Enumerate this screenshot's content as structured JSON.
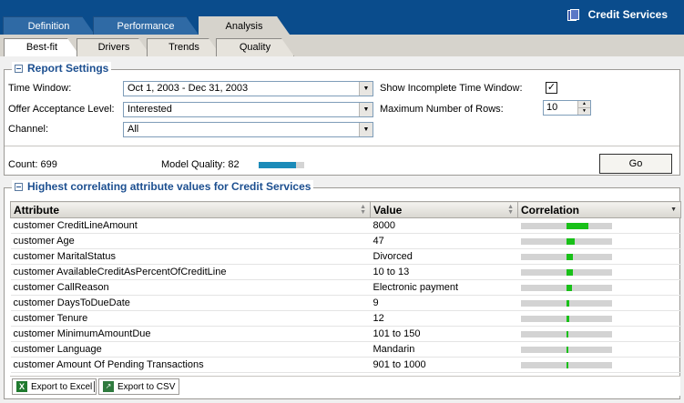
{
  "brand": {
    "title": "Credit Services"
  },
  "main_tabs": [
    {
      "label": "Definition"
    },
    {
      "label": "Performance"
    },
    {
      "label": "Analysis"
    }
  ],
  "sub_tabs": [
    {
      "label": "Best-fit"
    },
    {
      "label": "Drivers"
    },
    {
      "label": "Trends"
    },
    {
      "label": "Quality"
    }
  ],
  "report_settings": {
    "title": "Report Settings",
    "time_window_label": "Time Window:",
    "time_window_value": "Oct 1, 2003 - Dec 31, 2003",
    "offer_label": "Offer Acceptance Level:",
    "offer_value": "Interested",
    "channel_label": "Channel:",
    "channel_value": "All",
    "incomplete_label": "Show Incomplete Time Window:",
    "incomplete_checked": "✓",
    "max_rows_label": "Maximum Number of Rows:",
    "max_rows_value": "10",
    "count_text": "Count: 699",
    "quality_text": "Model Quality: 82",
    "quality_level_percent": 82,
    "go_label": "Go"
  },
  "correlation_table": {
    "title": "Highest correlating attribute values for Credit Services",
    "columns": [
      "Attribute",
      "Value",
      "Correlation"
    ],
    "rows": [
      {
        "attribute": "customer CreditLineAmount",
        "value": "8000",
        "correlation": 0.24
      },
      {
        "attribute": "customer Age",
        "value": "47",
        "correlation": 0.09
      },
      {
        "attribute": "customer MaritalStatus",
        "value": "Divorced",
        "correlation": 0.07
      },
      {
        "attribute": "customer AvailableCreditAsPercentOfCreditLine",
        "value": "10 to 13",
        "correlation": 0.07
      },
      {
        "attribute": "customer CallReason",
        "value": "Electronic payment",
        "correlation": 0.06
      },
      {
        "attribute": "customer DaysToDueDate",
        "value": "9",
        "correlation": 0.03
      },
      {
        "attribute": "customer Tenure",
        "value": "12",
        "correlation": 0.03
      },
      {
        "attribute": "customer MinimumAmountDue",
        "value": "101 to 150",
        "correlation": 0.02
      },
      {
        "attribute": "customer Language",
        "value": "Mandarin",
        "correlation": 0.02
      },
      {
        "attribute": "customer Amount Of Pending Transactions",
        "value": "901 to 1000",
        "correlation": 0.02
      }
    ],
    "correlation_range": [
      -0.5,
      0.5
    ],
    "bar_color": "#18c018"
  },
  "footer": {
    "export_excel": "Export to Excel",
    "export_csv": "Export to CSV"
  },
  "icons": {
    "brand": "folder-icon",
    "collapse": "minus-box-icon",
    "sort": "sort-arrows-icon",
    "excel": "excel-icon",
    "csv": "csv-icon"
  }
}
